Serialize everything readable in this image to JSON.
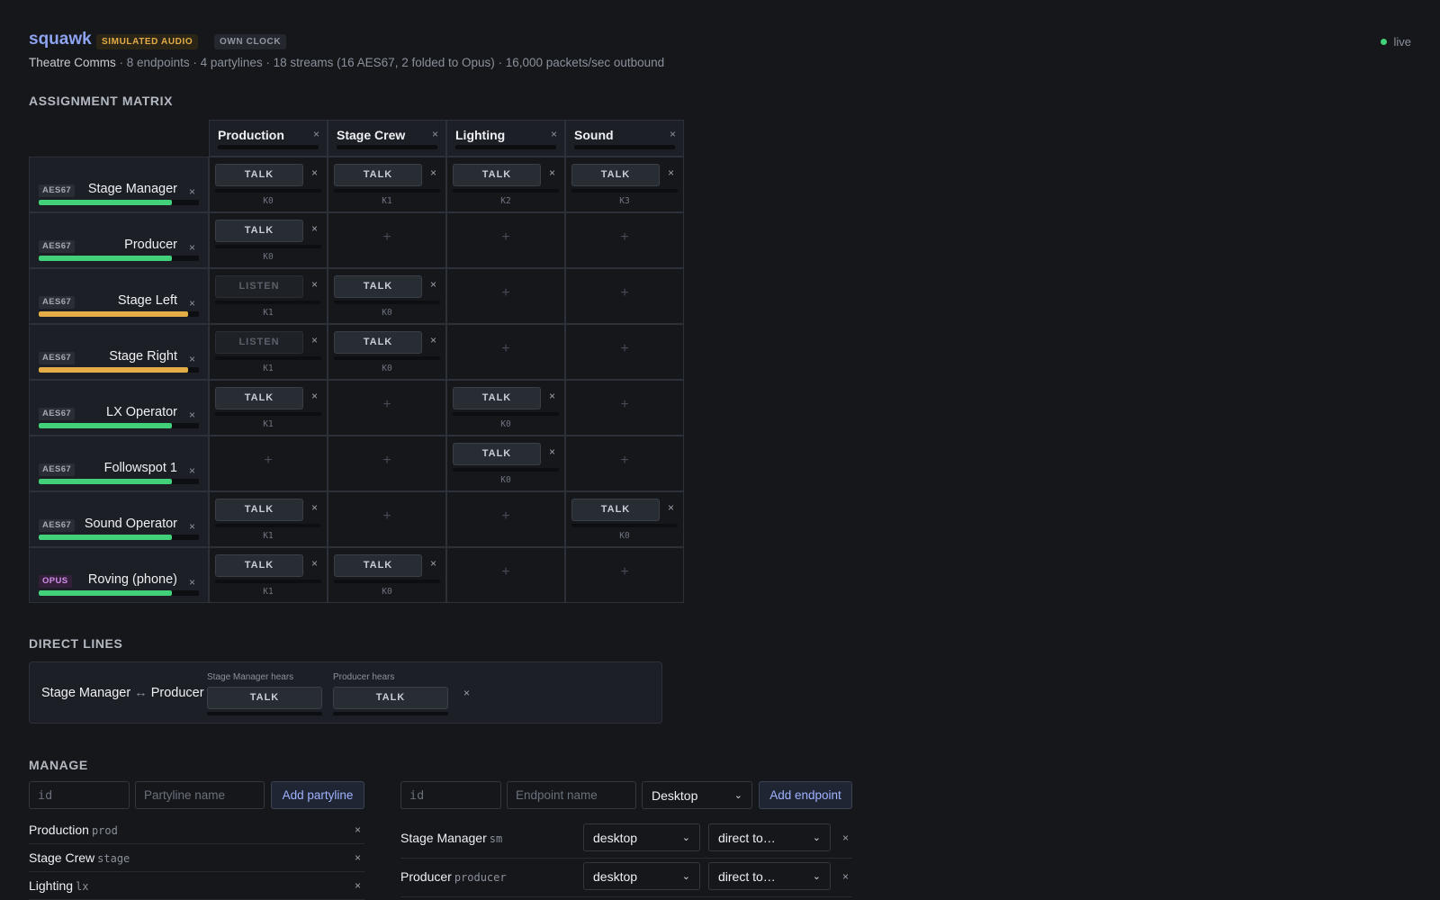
{
  "header": {
    "app_name": "squawk",
    "badge_simulated": "SIMULATED AUDIO",
    "badge_clock": "OWN CLOCK",
    "status": "live",
    "show_name": "Theatre Comms",
    "summary": " · 8 endpoints · 4 partylines · 18 streams (16 AES67, 2 folded to Opus) · 16,000 packets/sec outbound"
  },
  "colors": {
    "accent": "#8ea3f0",
    "live": "#43d07a",
    "meter_green": "#43d07a",
    "meter_amber": "#e3ac46",
    "opus": "#d08ee8"
  },
  "icons": {
    "close": "close-icon",
    "add": "plus-icon",
    "bidirectional": "bidirectional-arrow-icon",
    "status": "status-dot-icon",
    "dropdown": "chevron-down-icon"
  },
  "matrix": {
    "title": "ASSIGNMENT MATRIX",
    "close_glyph": "×",
    "add_glyph": "+",
    "columns": [
      "Production",
      "Stage Crew",
      "Lighting",
      "Sound"
    ],
    "rows": [
      {
        "name": "Stage Manager",
        "type": "AES67",
        "level": 0.83,
        "meter": "green",
        "cells": [
          {
            "mode": "TALK",
            "key": "K0"
          },
          {
            "mode": "TALK",
            "key": "K1"
          },
          {
            "mode": "TALK",
            "key": "K2"
          },
          {
            "mode": "TALK",
            "key": "K3"
          }
        ]
      },
      {
        "name": "Producer",
        "type": "AES67",
        "level": 0.83,
        "meter": "green",
        "cells": [
          {
            "mode": "TALK",
            "key": "K0"
          },
          null,
          null,
          null
        ]
      },
      {
        "name": "Stage Left",
        "type": "AES67",
        "level": 0.93,
        "meter": "amber",
        "cells": [
          {
            "mode": "LISTEN",
            "key": "K1"
          },
          {
            "mode": "TALK",
            "key": "K0"
          },
          null,
          null
        ]
      },
      {
        "name": "Stage Right",
        "type": "AES67",
        "level": 0.93,
        "meter": "amber",
        "cells": [
          {
            "mode": "LISTEN",
            "key": "K1"
          },
          {
            "mode": "TALK",
            "key": "K0"
          },
          null,
          null
        ]
      },
      {
        "name": "LX Operator",
        "type": "AES67",
        "level": 0.83,
        "meter": "green",
        "cells": [
          {
            "mode": "TALK",
            "key": "K1"
          },
          null,
          {
            "mode": "TALK",
            "key": "K0"
          },
          null
        ]
      },
      {
        "name": "Followspot 1",
        "type": "AES67",
        "level": 0.83,
        "meter": "green",
        "cells": [
          null,
          null,
          {
            "mode": "TALK",
            "key": "K0"
          },
          null
        ]
      },
      {
        "name": "Sound Operator",
        "type": "AES67",
        "level": 0.83,
        "meter": "green",
        "cells": [
          {
            "mode": "TALK",
            "key": "K1"
          },
          null,
          null,
          {
            "mode": "TALK",
            "key": "K0"
          }
        ]
      },
      {
        "name": "Roving (phone)",
        "type": "OPUS",
        "level": 0.83,
        "meter": "green",
        "cells": [
          {
            "mode": "TALK",
            "key": "K1"
          },
          {
            "mode": "TALK",
            "key": "K0"
          },
          null,
          null
        ]
      }
    ]
  },
  "direct_lines": {
    "title": "DIRECT LINES",
    "lines": [
      {
        "a": "Stage Manager",
        "arrow": "↔",
        "b": "Producer",
        "a_caption": "Stage Manager hears",
        "a_mode": "TALK",
        "b_caption": "Producer hears",
        "b_mode": "TALK",
        "close": "×"
      }
    ]
  },
  "manage": {
    "title": "MANAGE",
    "partyline_form": {
      "id_placeholder": "id",
      "name_placeholder": "Partyline name",
      "add_label": "Add partyline"
    },
    "endpoint_form": {
      "id_placeholder": "id",
      "name_placeholder": "Endpoint name",
      "kind_value": "Desktop",
      "add_label": "Add endpoint"
    },
    "partylines": [
      {
        "name": "Production",
        "id": "prod",
        "close": "×"
      },
      {
        "name": "Stage Crew",
        "id": "stage",
        "close": "×"
      },
      {
        "name": "Lighting",
        "id": "lx",
        "close": "×"
      }
    ],
    "endpoints": [
      {
        "name": "Stage Manager",
        "id": "sm",
        "kind": "desktop",
        "route": "direct to…",
        "close": "×"
      },
      {
        "name": "Producer",
        "id": "producer",
        "kind": "desktop",
        "route": "direct to…",
        "close": "×"
      }
    ]
  }
}
